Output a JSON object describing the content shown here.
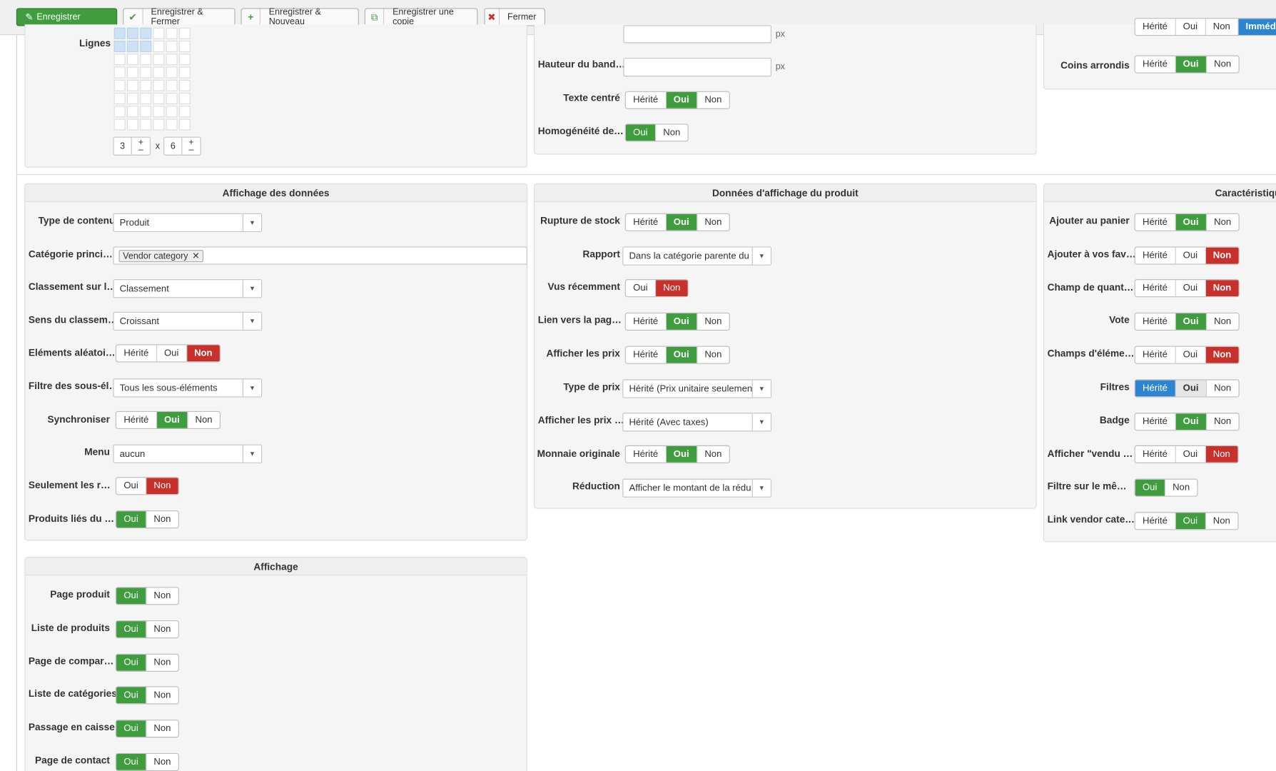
{
  "toolbar": {
    "save": "Enregistrer",
    "save_close": "Enregistrer & Fermer",
    "save_new": "Enregistrer & Nouveau",
    "save_copy": "Enregistrer une copie",
    "close": "Fermer"
  },
  "colors": {
    "green": "#3f9c3f",
    "red": "#c7302b",
    "blue": "#2d84d1"
  },
  "top_left": {
    "rows_label": "Lignes",
    "cols_value": "3",
    "rows_value": "6",
    "times": "x",
    "plus": "+",
    "minus": "–"
  },
  "top_middle": {
    "unit_px": "px",
    "height_label": "Hauteur du band…",
    "center_label": "Texte centré",
    "homog_label": "Homogénéité de…",
    "herite": "Hérité",
    "oui": "Oui",
    "non": "Non"
  },
  "top_right": {
    "partial_herite": "Hérité",
    "partial_oui": "Oui",
    "partial_non": "Non",
    "partial_blue": "Immédia",
    "rounded_label": "Coins arrondis",
    "herite": "Hérité",
    "oui": "Oui",
    "non": "Non"
  },
  "display_data": {
    "title": "Affichage des données",
    "content_type_label": "Type de contenu",
    "content_type_value": "Produit",
    "main_cat_label": "Catégorie princi…",
    "main_cat_tag": "Vendor category",
    "order_label": "Classement sur l…",
    "order_value": "Classement",
    "sort_label": "Sens du classem…",
    "sort_value": "Croissant",
    "random_label": "Eléments aléatoi…",
    "filter_label": "Filtre des sous-él…",
    "filter_value": "Tous les sous-éléments",
    "sync_label": "Synchroniser",
    "menu_label": "Menu",
    "menu_value": "aucun",
    "only_label": "Seulement les r…",
    "linked_label": "Produits liés du …",
    "herite": "Hérité",
    "oui": "Oui",
    "non": "Non"
  },
  "product_display": {
    "title": "Données d'affichage du produit",
    "stock_label": "Rupture de stock",
    "report_label": "Rapport",
    "report_value": "Dans la catégorie parente du …",
    "recent_label": "Vus récemment",
    "link_label": "Lien vers la pag…",
    "prices_label": "Afficher les prix",
    "price_type_label": "Type de prix",
    "price_type_value": "Hérité (Prix unitaire seulement)",
    "prices_tax_label": "Afficher les prix …",
    "prices_tax_value": "Hérité (Avec taxes)",
    "currency_label": "Monnaie originale",
    "discount_label": "Réduction",
    "discount_value": "Afficher le montant de la rédu…",
    "herite": "Hérité",
    "oui": "Oui",
    "non": "Non"
  },
  "features": {
    "title": "Caractéristiques",
    "cart_label": "Ajouter au panier",
    "fav_label": "Ajouter à vos fav…",
    "qty_label": "Champ de quant…",
    "vote_label": "Vote",
    "fields_label": "Champs d'éléme…",
    "filters_label": "Filtres",
    "badge_label": "Badge",
    "sold_label": "Afficher \"vendu …",
    "same_filter_label": "Filtre sur le mê…",
    "vendor_link_label": "Link vendor cate…",
    "herite": "Hérité",
    "oui": "Oui",
    "non": "Non"
  },
  "affichage": {
    "title": "Affichage",
    "rows": [
      "Page produit",
      "Liste de produits",
      "Page de compar…",
      "Liste de catégories",
      "Passage en caisse",
      "Page de contact"
    ],
    "oui": "Oui",
    "non": "Non"
  }
}
